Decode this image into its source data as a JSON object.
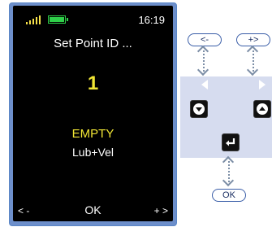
{
  "screen": {
    "time": "16:19",
    "title": "Set Point ID ...",
    "point_id": "1",
    "status": "EMPTY",
    "mode": "Lub+Vel",
    "softkeys": {
      "left": "< -",
      "center": "OK",
      "right": "+ >"
    }
  },
  "keypad": {
    "minus_label": "<-",
    "plus_label": "+>",
    "ok_label": "OK"
  },
  "icons": {
    "signal": "signal-bars-icon",
    "battery": "battery-icon",
    "down": "down-triangle-icon",
    "up": "up-triangle-icon",
    "enter": "enter-return-icon"
  },
  "colors": {
    "accent_yellow": "#f1e635",
    "battery_green": "#2fd04a",
    "frame_blue": "#6d8fcb",
    "panel": "#d6dcef"
  }
}
